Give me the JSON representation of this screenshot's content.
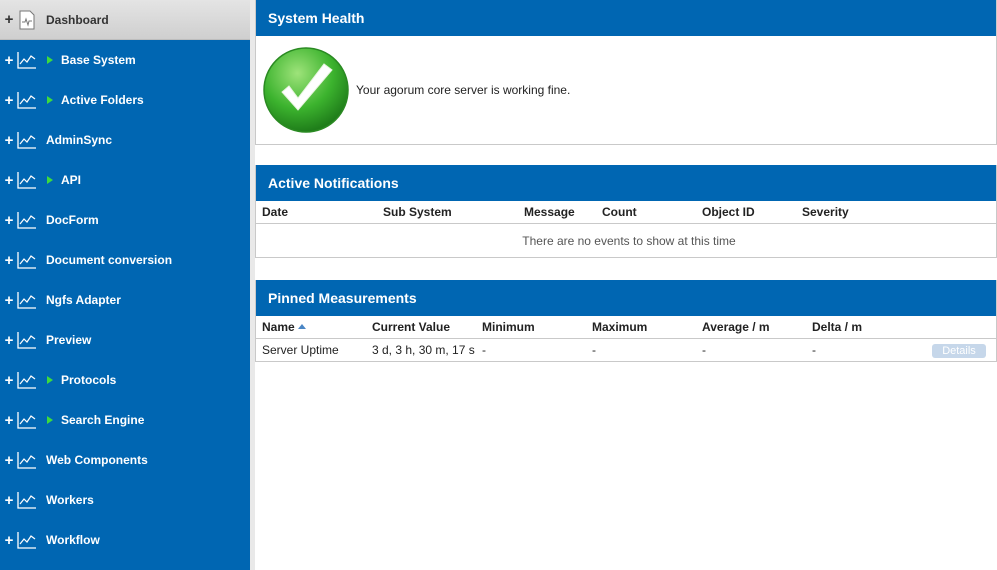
{
  "sidebar": {
    "items": [
      {
        "label": "Dashboard",
        "active": true,
        "arrow": false,
        "icon": "document-chart-icon"
      },
      {
        "label": "Base System",
        "arrow": true,
        "icon": "line-chart-icon"
      },
      {
        "label": "Active Folders",
        "arrow": true,
        "icon": "line-chart-icon"
      },
      {
        "label": "AdminSync",
        "arrow": false,
        "icon": "line-chart-icon"
      },
      {
        "label": "API",
        "arrow": true,
        "icon": "line-chart-icon"
      },
      {
        "label": "DocForm",
        "arrow": false,
        "icon": "line-chart-icon"
      },
      {
        "label": "Document conversion",
        "arrow": false,
        "icon": "line-chart-icon"
      },
      {
        "label": "Ngfs Adapter",
        "arrow": false,
        "icon": "line-chart-icon"
      },
      {
        "label": "Preview",
        "arrow": false,
        "icon": "line-chart-icon"
      },
      {
        "label": "Protocols",
        "arrow": true,
        "icon": "line-chart-icon"
      },
      {
        "label": "Search Engine",
        "arrow": true,
        "icon": "line-chart-icon"
      },
      {
        "label": "Web Components",
        "arrow": false,
        "icon": "line-chart-icon"
      },
      {
        "label": "Workers",
        "arrow": false,
        "icon": "line-chart-icon"
      },
      {
        "label": "Workflow",
        "arrow": false,
        "icon": "line-chart-icon"
      }
    ],
    "expand_symbol": "+"
  },
  "health": {
    "title": "System Health",
    "message": "Your agorum core server is working fine.",
    "icon": "green-check-icon"
  },
  "notifications": {
    "title": "Active Notifications",
    "columns": [
      "Date",
      "Sub System",
      "Message",
      "Count",
      "Object ID",
      "Severity"
    ],
    "empty": "There are no events to show at this time"
  },
  "pinned": {
    "title": "Pinned Measurements",
    "columns": [
      "Name",
      "Current Value",
      "Minimum",
      "Maximum",
      "Average / m",
      "Delta / m"
    ],
    "rows": [
      {
        "name": "Server Uptime",
        "current": "3 d, 3 h, 30 m, 17 s",
        "min": "-",
        "max": "-",
        "avg": "-",
        "delta": "-",
        "button": "Details"
      }
    ]
  },
  "colors": {
    "brand": "#0066b2",
    "arrow": "#3ddc3d",
    "check": "#3cb32e"
  }
}
